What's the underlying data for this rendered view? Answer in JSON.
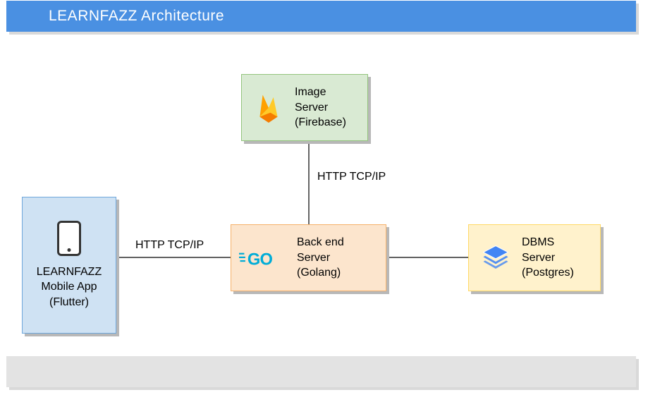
{
  "header": {
    "title": "LEARNFAZZ Architecture"
  },
  "nodes": {
    "mobile": {
      "line1": "LEARNFAZZ",
      "line2": "Mobile App",
      "line3": "(Flutter)"
    },
    "image": {
      "line1": "Image",
      "line2": "Server",
      "line3": "(Firebase)"
    },
    "backend": {
      "line1": "Back end",
      "line2": "Server",
      "line3": "(Golang)"
    },
    "dbms": {
      "line1": "DBMS",
      "line2": "Server",
      "line3": "(Postgres)"
    }
  },
  "edges": {
    "mobile_backend": "HTTP TCP/IP",
    "image_backend": "HTTP TCP/IP"
  },
  "icons": {
    "phone": "phone-icon",
    "firebase": "firebase-icon",
    "go": "go-icon",
    "stack": "stack-icon"
  },
  "colors": {
    "header_bg": "#4a90e2",
    "blue_fill": "#cfe2f3",
    "green_fill": "#d9ead3",
    "orange_fill": "#fce5cd",
    "yellow_fill": "#fff2cc"
  }
}
